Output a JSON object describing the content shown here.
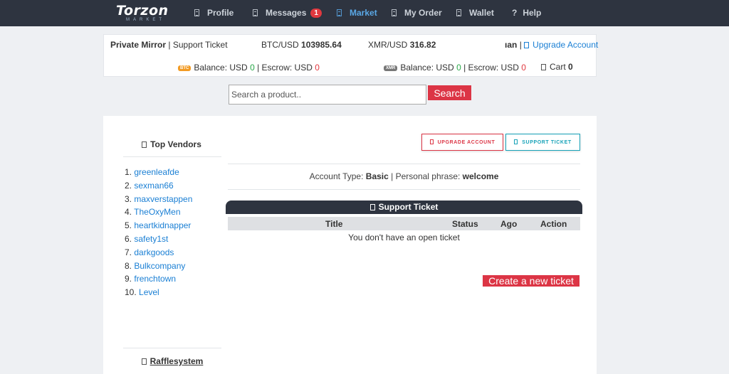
{
  "nav": {
    "logo_main": "Torzon",
    "logo_sub": "MARKET",
    "items": [
      {
        "label": "Profile",
        "icon": "document-icon"
      },
      {
        "label": "Messages",
        "icon": "document-icon",
        "badge": "1"
      },
      {
        "label": "Market",
        "icon": "document-icon",
        "active": true
      },
      {
        "label": "My Order",
        "icon": "document-icon"
      },
      {
        "label": "Wallet",
        "icon": "document-icon"
      },
      {
        "label": "Help",
        "icon": "question-icon",
        "glyph": "?"
      }
    ]
  },
  "header": {
    "mirror_label": "Private Mirror",
    "separator": "|",
    "support_ticket": "Support Ticket",
    "btc_label": "BTC/USD",
    "btc_value": "103985.64",
    "xmr_label": "XMR/USD",
    "xmr_value": "316.82",
    "username": "ıan",
    "upgrade_link": "Upgrade Account",
    "btc_tag": "BTC",
    "btc_balance_label": "Balance: USD",
    "btc_balance_value": "0",
    "btc_escrow_label": "| Escrow: USD",
    "btc_escrow_value": "0",
    "xmr_tag": "XMR",
    "xmr_balance_label": "Balance: USD",
    "xmr_balance_value": "0",
    "xmr_escrow_label": "| Escrow: USD",
    "xmr_escrow_value": "0",
    "cart_label": "Cart",
    "cart_count": "0"
  },
  "search": {
    "placeholder": "Search a product..",
    "button": "Search"
  },
  "sidebar": {
    "top_vendors_title": "Top Vendors",
    "vendors": [
      {
        "num": "1.",
        "name": "greenleafde"
      },
      {
        "num": "2.",
        "name": "sexman66"
      },
      {
        "num": "3.",
        "name": "maxverstappen"
      },
      {
        "num": "4.",
        "name": "TheOxyMen"
      },
      {
        "num": "5.",
        "name": "heartkidnapper"
      },
      {
        "num": "6.",
        "name": "safety1st"
      },
      {
        "num": "7.",
        "name": "darkgoods"
      },
      {
        "num": "8.",
        "name": "Bulkcompany"
      },
      {
        "num": "9.",
        "name": "frenchtown"
      },
      {
        "num": "10.",
        "name": "Level"
      }
    ],
    "raffle_title": "Rafflesystem"
  },
  "main": {
    "upgrade_button": "UPGRADE ACCOUNT",
    "support_button": "SUPPORT TICKET",
    "account_type_label": "Account Type:",
    "account_type_value": "Basic",
    "phrase_label": "| Personal phrase:",
    "phrase_value": "welcome",
    "ticket_section_title": "Support Ticket",
    "columns": [
      "Title",
      "Status",
      "Ago",
      "Action"
    ],
    "empty_message": "You don't have an open ticket",
    "create_button": "Create a new ticket"
  },
  "colors": {
    "nav_bg": "#2e3440",
    "accent_blue": "#1a7fd4",
    "danger": "#dc3545",
    "info": "#17a2b8",
    "success": "#2aa84a"
  }
}
